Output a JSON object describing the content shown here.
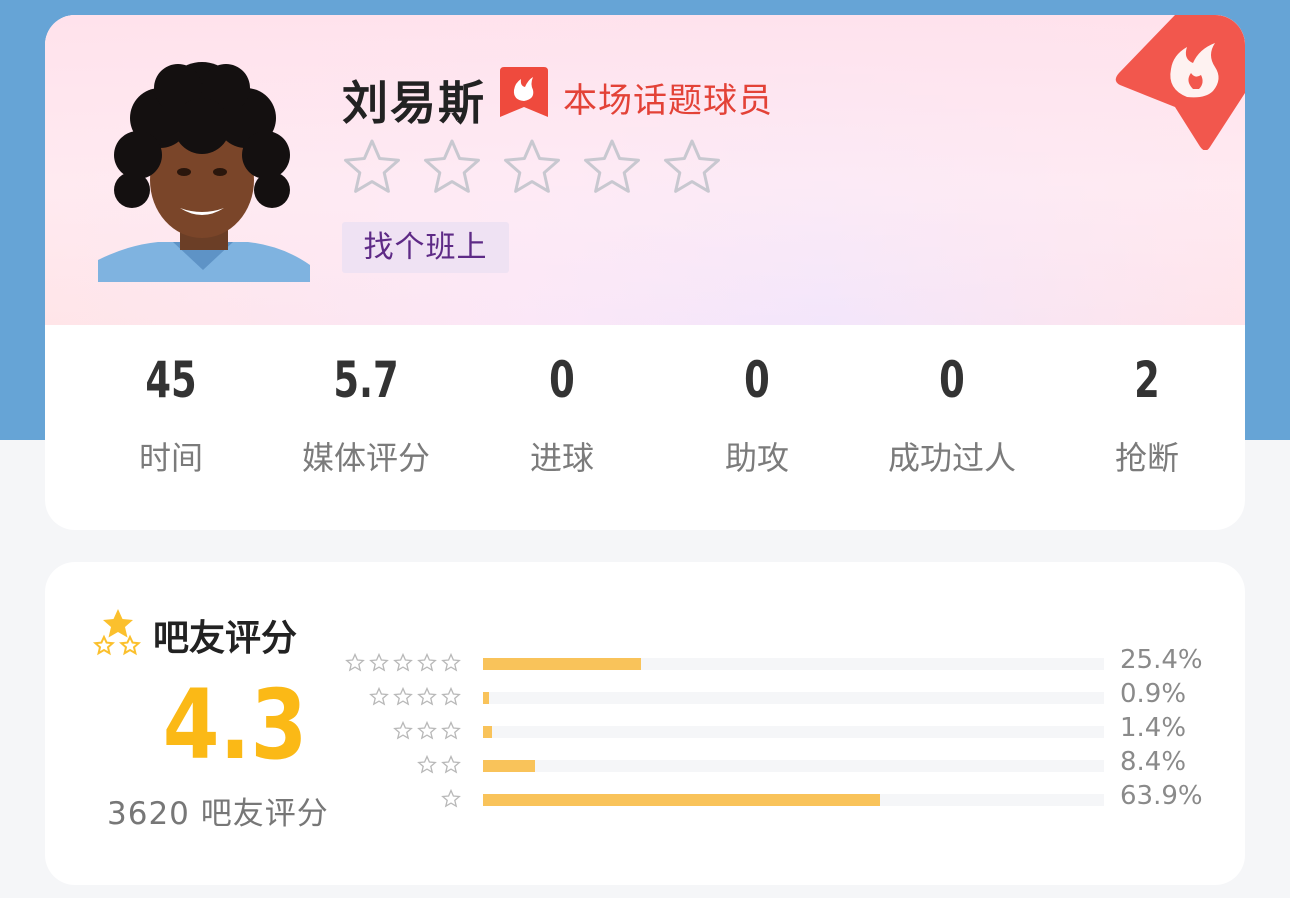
{
  "player": {
    "name": "刘易斯",
    "badge_label": "本场话题球员",
    "stars_filled": 0,
    "stars_total": 5,
    "tag": "找个班上"
  },
  "stats": [
    {
      "value": "45",
      "label": "时间"
    },
    {
      "value": "5.7",
      "label": "媒体评分"
    },
    {
      "value": "0",
      "label": "进球"
    },
    {
      "value": "0",
      "label": "助攻"
    },
    {
      "value": "0",
      "label": "成功过人"
    },
    {
      "value": "2",
      "label": "抢断"
    }
  ],
  "fan_rating": {
    "title": "吧友评分",
    "score": "4.3",
    "count_text": "3620 吧友评分",
    "breakdown": [
      {
        "stars": 5,
        "percent_text": "25.4%",
        "percent": 25.4
      },
      {
        "stars": 4,
        "percent_text": "0.9%",
        "percent": 0.9
      },
      {
        "stars": 3,
        "percent_text": "1.4%",
        "percent": 1.4
      },
      {
        "stars": 2,
        "percent_text": "8.4%",
        "percent": 8.4
      },
      {
        "stars": 1,
        "percent_text": "63.9%",
        "percent": 63.9
      }
    ]
  },
  "colors": {
    "accent_orange": "#fbb916",
    "bar_fill": "#f9c35a",
    "topic_red": "#e34237",
    "tag_purple": "#5e2a86",
    "header_blue": "#66a4d6"
  },
  "icons": {
    "topic": "flame-bookmark-icon",
    "hot_badge": "hot-flame-icon",
    "fan_title": "stars-icon",
    "rating_star": "star-outline-icon"
  }
}
